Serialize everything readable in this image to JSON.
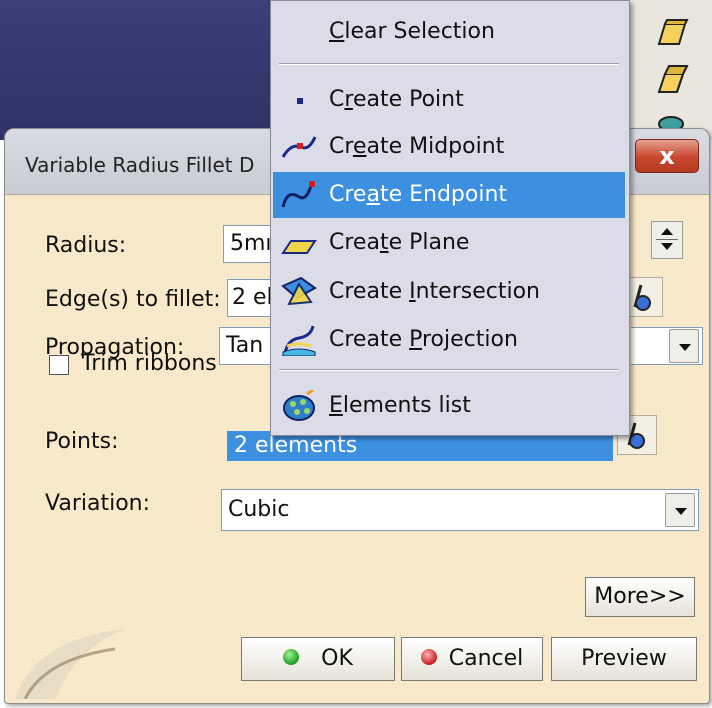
{
  "dialog": {
    "title": "Variable Radius Fillet D",
    "close_label": "x",
    "radius_label": "Radius:",
    "radius_value": "5mı",
    "edges_label": "Edge(s) to fillet:",
    "edges_value": "2 el",
    "propagation_label": "Propagation:",
    "propagation_value": "Tan",
    "trim_label": "Trim ribbons",
    "trim_checked": false,
    "points_label": "Points:",
    "points_value": "2 elements",
    "variation_label": "Variation:",
    "variation_value": "Cubic",
    "more_label": "More>>",
    "ok_label": "OK",
    "cancel_label": "Cancel",
    "preview_label": "Preview"
  },
  "menu": {
    "items": [
      {
        "pre": "",
        "u": "C",
        "post": "lear Selection",
        "icon": "none"
      },
      {
        "pre": "C",
        "u": "r",
        "post": "eate Point",
        "icon": "point-icon"
      },
      {
        "pre": "Cr",
        "u": "e",
        "post": "ate Midpoint",
        "icon": "midpoint-icon"
      },
      {
        "pre": "Cre",
        "u": "a",
        "post": "te Endpoint",
        "icon": "endpoint-icon"
      },
      {
        "pre": "Crea",
        "u": "t",
        "post": "e Plane",
        "icon": "plane-icon"
      },
      {
        "pre": "Create ",
        "u": "I",
        "post": "ntersection",
        "icon": "intersection-icon"
      },
      {
        "pre": "Create ",
        "u": "P",
        "post": "rojection",
        "icon": "projection-icon"
      },
      {
        "pre": "",
        "u": "E",
        "post": "lements list",
        "icon": "elements-list-icon"
      }
    ],
    "selected_index": 3
  },
  "colors": {
    "dialog_bg": "#f7e7c4",
    "menu_bg": "#dcdbe8",
    "menu_highlight": "#3d8fe0",
    "points_field_bg": "#3d8fe0"
  }
}
